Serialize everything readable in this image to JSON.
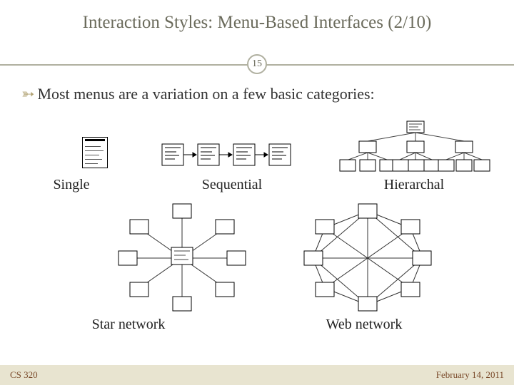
{
  "title": "Interaction Styles: Menu-Based Interfaces (2/10)",
  "page_number": "15",
  "bullet_text": "Most menus are a variation on a few basic categories:",
  "labels": {
    "single": "Single",
    "sequential": "Sequential",
    "hierarchical": "Hierarchal",
    "star": "Star network",
    "web": "Web network"
  },
  "footer": {
    "course": "CS 320",
    "date": "February 14, 2011"
  }
}
